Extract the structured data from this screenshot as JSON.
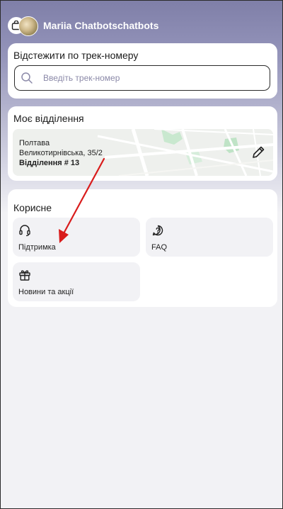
{
  "header": {
    "username": "Mariia Chatbotschatbots",
    "icons": [
      "shopping-bag-icon",
      "avatar"
    ]
  },
  "track": {
    "title": "Відстежити по трек-номеру",
    "placeholder": "Введіть трек-номер",
    "icon": "search-icon"
  },
  "branch": {
    "title": "Моє відділення",
    "city": "Полтава",
    "street": "Великотирнівська, 35/2",
    "number": "Відділення # 13",
    "icon": "pencil-icon"
  },
  "useful": {
    "title": "Корисне",
    "items": [
      {
        "label": "Підтримка",
        "icon": "headset-icon"
      },
      {
        "label": "FAQ",
        "icon": "question-chat-icon"
      },
      {
        "label": "Новини та акції",
        "icon": "gift-icon"
      }
    ]
  },
  "colors": {
    "header_gradient_top": "#7f7fa8",
    "page_bg": "#f2f2f5",
    "annotation_arrow": "#d91c1c"
  }
}
